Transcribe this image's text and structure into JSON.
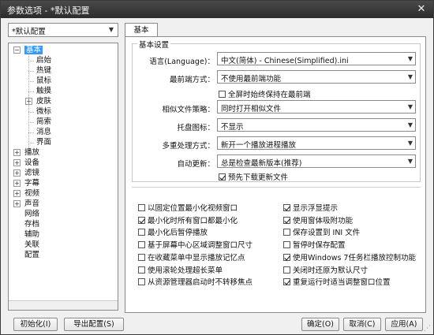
{
  "window": {
    "title": "参数选项 - *默认配置",
    "close_glyph": "✕"
  },
  "profile_select": {
    "value": "*默认配置"
  },
  "tree": {
    "items": [
      {
        "label": "基本",
        "level": 0,
        "expander": "-",
        "selected": true
      },
      {
        "label": "启始",
        "level": 1
      },
      {
        "label": "热键",
        "level": 1
      },
      {
        "label": "鼠标",
        "level": 1
      },
      {
        "label": "触摸",
        "level": 1
      },
      {
        "label": "皮肤",
        "level": 1,
        "expander": "+"
      },
      {
        "label": "微标",
        "level": 1
      },
      {
        "label": "简索",
        "level": 1
      },
      {
        "label": "消息",
        "level": 1
      },
      {
        "label": "界面",
        "level": 1
      },
      {
        "label": "播放",
        "level": 0,
        "expander": "+"
      },
      {
        "label": "设备",
        "level": 0,
        "expander": "+"
      },
      {
        "label": "滤镜",
        "level": 0,
        "expander": "+"
      },
      {
        "label": "字幕",
        "level": 0,
        "expander": "+"
      },
      {
        "label": "视频",
        "level": 0,
        "expander": "+"
      },
      {
        "label": "声音",
        "level": 0,
        "expander": "+"
      },
      {
        "label": "网络",
        "level": 0
      },
      {
        "label": "存档",
        "level": 0
      },
      {
        "label": "辅助",
        "level": 0
      },
      {
        "label": "关联",
        "level": 0
      },
      {
        "label": "配置",
        "level": 0
      }
    ]
  },
  "tabs": [
    {
      "label": "基本",
      "active": true
    }
  ],
  "basic": {
    "group_title": "基本设置",
    "rows": [
      {
        "label": "语言(Language)：",
        "value": "中文(简体) - Chinese(Simplified).ini"
      },
      {
        "label": "最前端方式：",
        "value": "不使用最前端功能"
      },
      {
        "label": "相似文件策略：",
        "value": "同时打开相似文件"
      },
      {
        "label": "托盘图标：",
        "value": "不显示"
      },
      {
        "label": "多重处理方式：",
        "value": "新开一个播放进程播放"
      },
      {
        "label": "自动更新：",
        "value": "总是检查最新版本(推荐)"
      }
    ],
    "fullscreen_topmost": {
      "label": "全屏时始终保持在最前端",
      "checked": false
    },
    "predownload": {
      "label": "预先下载更新文件",
      "checked": true
    },
    "options_left": [
      {
        "label": "以固定位置最小化视频窗口",
        "checked": false
      },
      {
        "label": "最小化时所有窗口都最小化",
        "checked": true
      },
      {
        "label": "最小化后暂停播放",
        "checked": false
      },
      {
        "label": "基于屏幕中心区域调整窗口尺寸",
        "checked": false
      },
      {
        "label": "在收藏菜单中显示播放记忆点",
        "checked": false
      },
      {
        "label": "使用滚轮处理超长菜单",
        "checked": false
      },
      {
        "label": "从资源管理器启动时不转移焦点",
        "checked": false
      }
    ],
    "options_right": [
      {
        "label": "显示浮显提示",
        "checked": true
      },
      {
        "label": "使用窗体吸附功能",
        "checked": true
      },
      {
        "label": "保存设置到 INI 文件",
        "checked": false
      },
      {
        "label": "暂停时保存配置",
        "checked": false
      },
      {
        "label": "使用Windows 7任务栏播放控制功能",
        "checked": true
      },
      {
        "label": "关闭时还原为默认尺寸",
        "checked": false
      },
      {
        "label": "重复运行时适当调整窗口位置",
        "checked": true
      }
    ]
  },
  "buttons": {
    "init": "初始化(I)",
    "export": "导出配置(S)",
    "ok": "确定(O)",
    "cancel": "取消(C)",
    "apply": "应用(A)"
  }
}
